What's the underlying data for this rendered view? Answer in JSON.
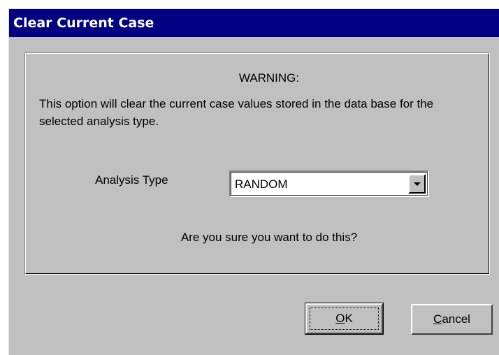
{
  "window": {
    "title": "Clear Current Case"
  },
  "warning": {
    "heading": "WARNING:",
    "body": "This option will clear the current case values stored in the data base for the selected analysis type."
  },
  "analysis": {
    "label": "Analysis Type",
    "selected_value": "RANDOM"
  },
  "confirm": {
    "question": "Are you sure you want to do this?"
  },
  "buttons": {
    "ok_mnemonic": "O",
    "ok_rest": "K",
    "cancel_mnemonic": "C",
    "cancel_rest": "ancel"
  },
  "colors": {
    "titlebar": "#000080",
    "dialog_face": "#c0c0c0"
  },
  "icons": {
    "combo_arrow": "chevron-down-icon"
  }
}
